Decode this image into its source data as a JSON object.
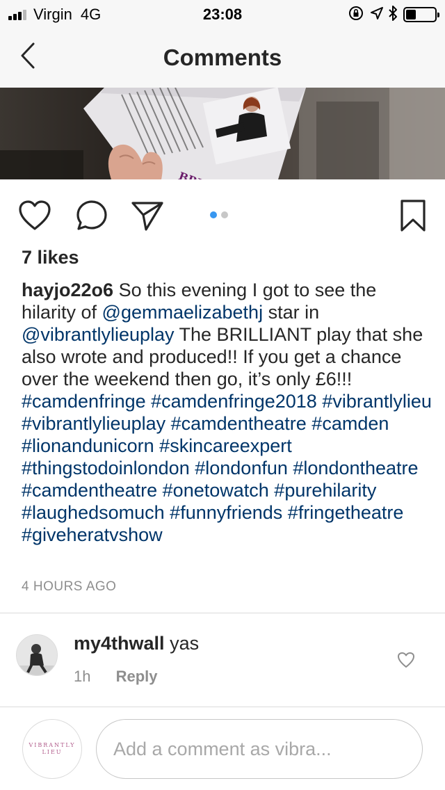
{
  "status_bar": {
    "carrier": "Virgin",
    "network": "4G",
    "time": "23:08"
  },
  "nav": {
    "title": "Comments",
    "back_icon": "chevron-left-icon"
  },
  "post": {
    "likes": "7 likes",
    "caption": {
      "username": "hayjo22o6",
      "segments": [
        {
          "type": "text",
          "value": " So this evening I got to see the hilarity of "
        },
        {
          "type": "link",
          "value": "@gemmaelizabethj"
        },
        {
          "type": "text",
          "value": " star in "
        },
        {
          "type": "link",
          "value": "@vibrantlylieuplay"
        },
        {
          "type": "text",
          "value": " The BRILLIANT play that she also wrote and produced!! If you get a chance over the weekend then go, it’s only £6!!! "
        },
        {
          "type": "link",
          "value": "#camdenfringe"
        },
        {
          "type": "text",
          "value": " "
        },
        {
          "type": "link",
          "value": "#camdenfringe2018"
        },
        {
          "type": "text",
          "value": " "
        },
        {
          "type": "link",
          "value": "#vibrantlylieu"
        },
        {
          "type": "text",
          "value": " "
        },
        {
          "type": "link",
          "value": "#vibrantlylieuplay"
        },
        {
          "type": "text",
          "value": " "
        },
        {
          "type": "link",
          "value": "#camdentheatre"
        },
        {
          "type": "text",
          "value": " "
        },
        {
          "type": "link",
          "value": "#camden"
        },
        {
          "type": "text",
          "value": " "
        },
        {
          "type": "link",
          "value": "#lionandunicorn"
        },
        {
          "type": "text",
          "value": " "
        },
        {
          "type": "link",
          "value": "#skincareexpert"
        },
        {
          "type": "text",
          "value": " "
        },
        {
          "type": "link",
          "value": "#thingstodoinlondon"
        },
        {
          "type": "text",
          "value": " "
        },
        {
          "type": "link",
          "value": "#londonfun"
        },
        {
          "type": "text",
          "value": " "
        },
        {
          "type": "link",
          "value": "#londontheatre"
        },
        {
          "type": "text",
          "value": " "
        },
        {
          "type": "link",
          "value": "#camdentheatre"
        },
        {
          "type": "text",
          "value": " "
        },
        {
          "type": "link",
          "value": "#onetowatch"
        },
        {
          "type": "text",
          "value": " "
        },
        {
          "type": "link",
          "value": "#purehilarity"
        },
        {
          "type": "text",
          "value": " "
        },
        {
          "type": "link",
          "value": "#laughedsomuch"
        },
        {
          "type": "text",
          "value": " "
        },
        {
          "type": "link",
          "value": "#funnyfriends"
        },
        {
          "type": "text",
          "value": " "
        },
        {
          "type": "link",
          "value": "#fringetheatre"
        },
        {
          "type": "text",
          "value": " "
        },
        {
          "type": "link",
          "value": "#giveheratvshow"
        }
      ]
    },
    "time_ago": "4 HOURS AGO",
    "carousel": {
      "active_color": "#3897f0",
      "inactive_color": "#c7c7c7"
    }
  },
  "comments": [
    {
      "username": "my4thwall",
      "text": "yas",
      "age": "1h",
      "reply_label": "Reply"
    }
  ],
  "composer": {
    "placeholder": "Add a comment as vibra...",
    "avatar_text_line1": "VIBRANTLY",
    "avatar_text_line2": "LIEU"
  },
  "colors": {
    "link": "#003569",
    "muted": "#8e8e8e",
    "text": "#262626",
    "bar_bg": "#f7f7f7"
  }
}
